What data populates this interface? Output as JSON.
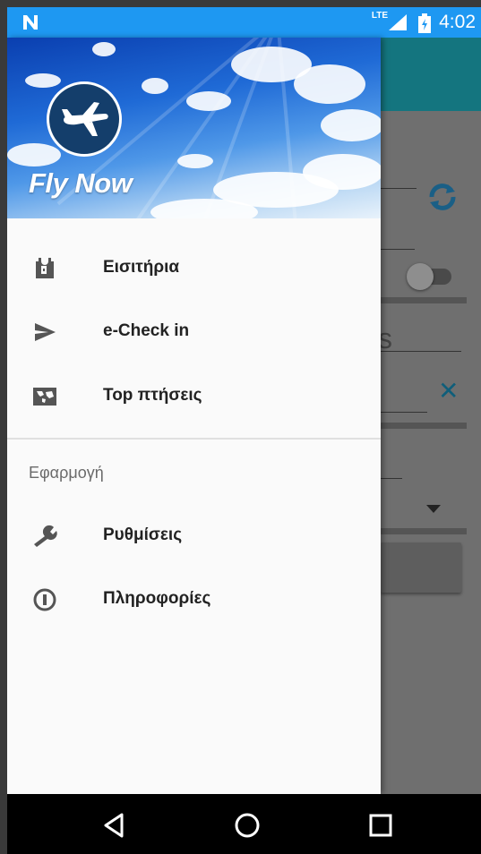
{
  "status_bar": {
    "network": "LTE",
    "time": "4:02",
    "bg_color": "#1e98f2"
  },
  "drawer": {
    "app_name": "Fly Now",
    "items": [
      {
        "label": "Εισιτήρια",
        "icon": "ticket-icon"
      },
      {
        "label": "e-Check in",
        "icon": "send-icon"
      },
      {
        "label": "Top πτήσεις",
        "icon": "map-icon"
      }
    ],
    "section_title": "Εφαρμογή",
    "section_items": [
      {
        "label": "Ρυθμίσεις",
        "icon": "wrench-icon"
      },
      {
        "label": "Πληροφορίες",
        "icon": "info-icon"
      }
    ]
  },
  "nav_bar": {
    "buttons": [
      "back-icon",
      "home-icon",
      "recents-icon"
    ]
  },
  "colors": {
    "toolbar_teal": "#14757f",
    "accent_blue": "#0f5e7a"
  }
}
